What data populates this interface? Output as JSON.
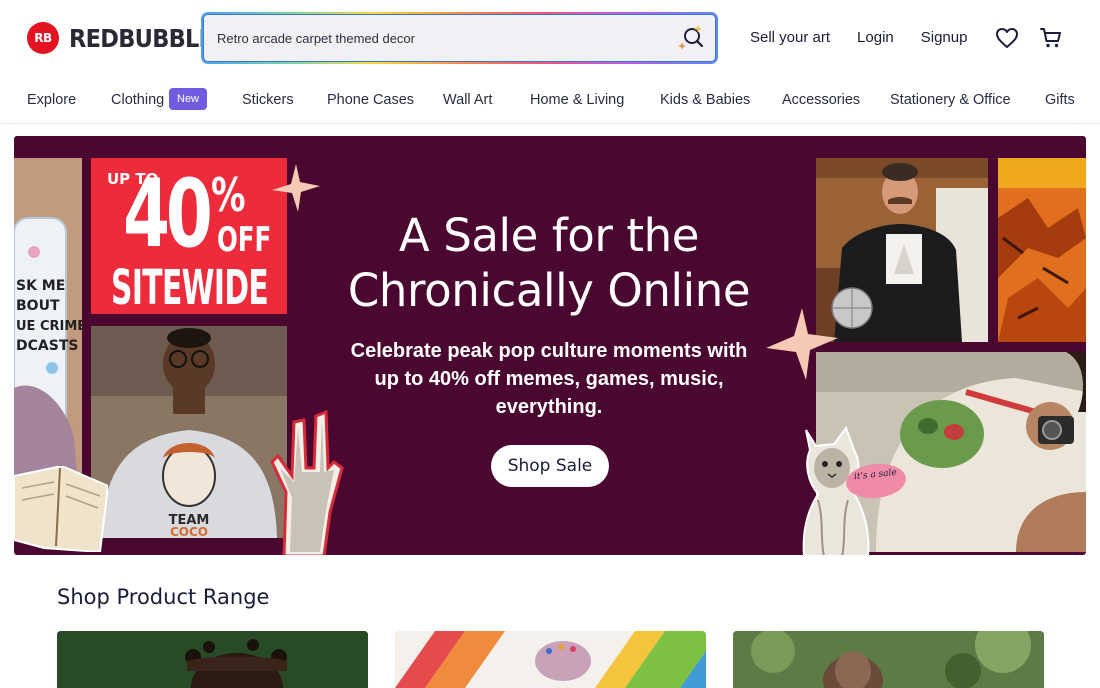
{
  "brand": {
    "name": "REDBUBBLE",
    "mark": "RB",
    "color": "#e41321"
  },
  "search": {
    "value": "Retro arcade carpet themed decor",
    "icon": "search-sparkle-icon"
  },
  "top_links": [
    "Sell your art",
    "Login",
    "Signup"
  ],
  "icons": {
    "wishlist": "heart-icon",
    "cart": "cart-icon"
  },
  "nav": {
    "items": [
      "Explore",
      "Clothing",
      "Stickers",
      "Phone Cases",
      "Wall Art",
      "Home & Living",
      "Kids & Babies",
      "Accessories",
      "Stationery & Office",
      "Gifts"
    ],
    "badge": "New"
  },
  "banner": {
    "background": "#4a0830",
    "title_line1": "A Sale for the",
    "title_line2": "Chronically Online",
    "subtitle": "Celebrate peak pop culture moments with up to 40% off memes, games, music, everything.",
    "cta": "Shop Sale",
    "sale_card": {
      "upto": "UP TO",
      "percent": "40",
      "pct_sign": "%",
      "off": "OFF",
      "sitewide": "SITEWIDE"
    },
    "phone_case_text": "ASK ME ABOUT TRUE CRIME PODCASTS",
    "sweatshirt_text": "TEAM COCO",
    "sticker_text": "it's a sale"
  },
  "section": {
    "title": "Shop Product Range"
  }
}
